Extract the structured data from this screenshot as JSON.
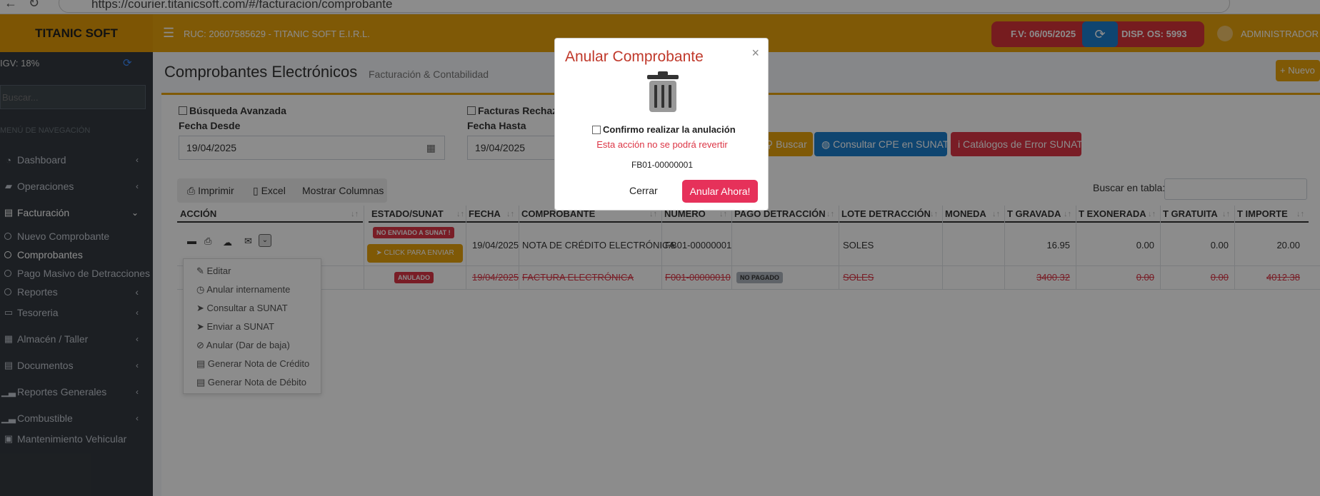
{
  "browser": {
    "url": "https://courier.titanicsoft.com/#/facturacion/comprobante"
  },
  "header": {
    "brand": "TITANIC SOFT",
    "ruc": "RUC: 20607585629 - TITANIC SOFT E.I.R.L.",
    "fv": "F.V: 06/05/2025",
    "disp": "DISP. OS: 5993",
    "user": "ADMINISTRADOR"
  },
  "sidebar": {
    "igv": "IGV: 18%",
    "search_placeholder": "Buscar...",
    "nav_header": "MENÚ DE NAVEGACIÓN",
    "items": [
      {
        "label": "Dashboard"
      },
      {
        "label": "Operaciones"
      },
      {
        "label": "Facturación"
      },
      {
        "label": "Tesoreria"
      },
      {
        "label": "Almacén / Taller"
      },
      {
        "label": "Documentos"
      },
      {
        "label": "Reportes Generales"
      },
      {
        "label": "Combustible"
      },
      {
        "label": "Mantenimiento Vehicular"
      }
    ],
    "subitems": [
      {
        "label": "Nuevo Comprobante"
      },
      {
        "label": "Comprobantes"
      },
      {
        "label": "Pago Masivo de Detracciones"
      },
      {
        "label": "Reportes"
      }
    ]
  },
  "page": {
    "title": "Comprobantes Electrónicos",
    "subtitle": "Facturación & Contabilidad",
    "new_button": "Nuevo"
  },
  "filters": {
    "advanced_search": "Búsqueda Avanzada",
    "rejected": "Facturas Rechazadas",
    "date_from_label": "Fecha Desde",
    "date_from": "19/04/2025",
    "date_to_label": "Fecha Hasta",
    "date_to": "19/04/2025",
    "search_button": "Buscar",
    "consult_button": "Consultar CPE en SUNAT",
    "catalog_button": "Catálogos de Error SUNAT"
  },
  "toolbar": {
    "print": "Imprimir",
    "excel": "Excel",
    "columns": "Mostrar Columnas",
    "table_search_label": "Buscar en tabla:"
  },
  "table": {
    "headers": [
      "ACCIÓN",
      "ESTADO/SUNAT",
      "FECHA",
      "COMPROBANTE",
      "NÚMERO",
      "PAGO DETRACCIÓN",
      "LOTE DETRACCIÓN",
      "MONEDA",
      "T GRAVADA",
      "T EXONERADA",
      "T GRATUITA",
      "T IMPORTE"
    ],
    "rows": [
      {
        "status": "NO ENVIADO A SUNAT !",
        "action": "CLICK PARA ENVIAR",
        "fecha": "19/04/2025",
        "comprobante": "NOTA DE CRÉDITO ELECTRÓNICA",
        "numero": "FB01-00000001",
        "pago": "",
        "lote": "",
        "moneda": "SOLES",
        "gravada": "16.95",
        "exonerada": "0.00",
        "gratuita": "0.00",
        "importe": "20.00"
      },
      {
        "status": "ANULADO",
        "fecha": "19/04/2025",
        "comprobante": "FACTURA ELECTRÓNICA",
        "numero": "F001-00000010",
        "pago": "NO PAGADO",
        "lote": "",
        "moneda": "SOLES",
        "gravada": "3400.32",
        "exonerada": "0.00",
        "gratuita": "0.00",
        "importe": "4012.38"
      }
    ]
  },
  "dropdown": {
    "items": [
      "Editar",
      "Anular internamente",
      "Consultar a SUNAT",
      "Enviar a SUNAT",
      "Anular (Dar de baja)",
      "Generar Nota de Crédito",
      "Generar Nota de Débito"
    ]
  },
  "modal": {
    "title": "Anular Comprobante",
    "close": "×",
    "confirm_label": "Confirmo realizar la anulación",
    "warning": "Esta acción no se podrá revertir",
    "document": "FB01-00000001",
    "cancel_button": "Cerrar",
    "confirm_button": "Anular Ahora!"
  }
}
